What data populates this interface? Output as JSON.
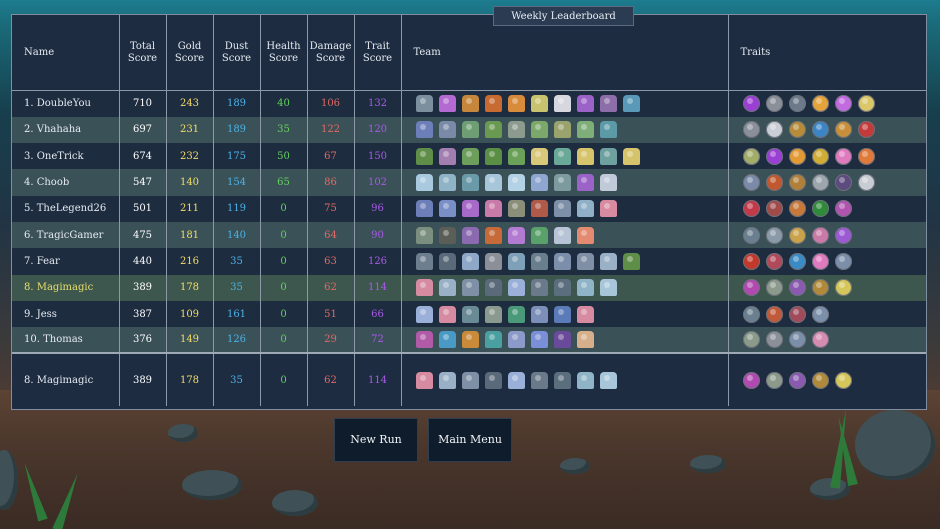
{
  "title": "Weekly Leaderboard",
  "headers": {
    "name": "Name",
    "total": [
      "Total",
      "Score"
    ],
    "gold": [
      "Gold",
      "Score"
    ],
    "dust": [
      "Dust",
      "Score"
    ],
    "health": [
      "Health",
      "Score"
    ],
    "damage": [
      "Damage",
      "Score"
    ],
    "trait": [
      "Trait",
      "Score"
    ],
    "team": "Team",
    "traits": "Traits"
  },
  "colors": {
    "total": "#ffffff",
    "gold": "#f3dd66",
    "dust": "#4bb2e6",
    "health": "#63d15c",
    "damage": "#e16a62",
    "trait": "#a85ae8",
    "highlight_name": "#e8de6a"
  },
  "rows": [
    {
      "name": "1. DoubleYou",
      "total": "710",
      "gold": "243",
      "dust": "189",
      "health": "40",
      "damage": "106",
      "trait": "132",
      "team": [
        "#7b8f9e",
        "#b46ad0",
        "#c6873c",
        "#c86b32",
        "#d88b3a",
        "#c9c36f",
        "#d7d7e0",
        "#9b63c7",
        "#8d6ea8",
        "#5a9ab8"
      ],
      "traits": [
        "#9b3fd4",
        "#8a8f98",
        "#6c7a8a",
        "#e4a33b",
        "#c26be0",
        "#d9c76a"
      ]
    },
    {
      "name": "2. Vhahaha",
      "total": "697",
      "gold": "231",
      "dust": "189",
      "health": "35",
      "damage": "122",
      "trait": "120",
      "team": [
        "#6d7fb8",
        "#7b8aa8",
        "#6e9e74",
        "#6a9a52",
        "#8c9b8e",
        "#7da86c",
        "#9aa36e",
        "#7fae78",
        "#5c9aa8"
      ],
      "traits": [
        "#8b8f99",
        "#c9ced6",
        "#b68c3a",
        "#3b84c6",
        "#c78f3a",
        "#c33a3a"
      ]
    },
    {
      "name": "3. OneTrick",
      "total": "674",
      "gold": "232",
      "dust": "175",
      "health": "50",
      "damage": "67",
      "trait": "150",
      "team": [
        "#5e8e48",
        "#a27fb0",
        "#6e9e5c",
        "#5a8e44",
        "#6aa057",
        "#d9c77a",
        "#6aa897",
        "#d6c46c",
        "#6fa0a0",
        "#d6c46c"
      ],
      "traits": [
        "#a2ad6a",
        "#9b3fd4",
        "#e49a33",
        "#d1ad36",
        "#e07abf",
        "#e07a3a"
      ]
    },
    {
      "name": "4. Choob",
      "total": "547",
      "gold": "140",
      "dust": "154",
      "health": "65",
      "damage": "86",
      "trait": "102",
      "team": [
        "#a9c9de",
        "#8fb3c7",
        "#6a9aa8",
        "#a8c6da",
        "#b3d2e6",
        "#8fa6d1",
        "#7d9a9e",
        "#9b63c7",
        "#c0cad8"
      ],
      "traits": [
        "#7a8aa8",
        "#c0592f",
        "#b0803a",
        "#9ea6ad",
        "#5d4a7e",
        "#c8cdd4"
      ]
    },
    {
      "name": "5. TheLegend26",
      "total": "501",
      "gold": "211",
      "dust": "119",
      "health": "0",
      "damage": "75",
      "trait": "96",
      "team": [
        "#6d7fb8",
        "#7a8fc8",
        "#a86ac9",
        "#c97aa8",
        "#8b8f7a",
        "#b05a4a",
        "#7d90a8",
        "#8fb0c7",
        "#d88ba0"
      ],
      "traits": [
        "#c23a4a",
        "#a04a4a",
        "#c8793a",
        "#2f8a3a",
        "#b054b0"
      ]
    },
    {
      "name": "6. TragicGamer",
      "total": "475",
      "gold": "181",
      "dust": "140",
      "health": "0",
      "damage": "64",
      "trait": "90",
      "team": [
        "#7b8f7e",
        "#5a5e56",
        "#8b6ab0",
        "#c66a3a",
        "#b27ad0",
        "#5aa06a",
        "#b7c4d6",
        "#e38a70"
      ],
      "traits": [
        "#6a8090",
        "#8b9aa8",
        "#c9a24a",
        "#c97aa8",
        "#9b5ad4"
      ]
    },
    {
      "name": "7. Fear",
      "total": "440",
      "gold": "216",
      "dust": "35",
      "health": "0",
      "damage": "63",
      "trait": "126",
      "team": [
        "#6d7f8e",
        "#5a6a7a",
        "#8fa8c7",
        "#8b8f98",
        "#7ea0b8",
        "#6a7f8e",
        "#7b8faa",
        "#7f90a6",
        "#9ab0c6",
        "#5e8e48"
      ],
      "traits": [
        "#c0392b",
        "#b04a5a",
        "#3a8ac6",
        "#e07abf",
        "#7b8faa"
      ]
    },
    {
      "name": "8. Magimagic",
      "total": "389",
      "gold": "178",
      "dust": "35",
      "health": "0",
      "damage": "62",
      "trait": "114",
      "self": true,
      "team": [
        "#d68ba0",
        "#9ab0c6",
        "#7f90a6",
        "#5a6a7a",
        "#9ab0d8",
        "#6a7a8a",
        "#5a6e7e",
        "#8fb3c7",
        "#a8c6da"
      ],
      "traits": [
        "#b04ab0",
        "#8b9a8a",
        "#8a5ab0",
        "#b08a3a",
        "#d4c65a"
      ]
    },
    {
      "name": "9. Jess",
      "total": "387",
      "gold": "109",
      "dust": "161",
      "health": "0",
      "damage": "51",
      "trait": "66",
      "team": [
        "#9ab0d8",
        "#d68ba0",
        "#6a8a96",
        "#8b9a8e",
        "#4a9a7a",
        "#7b8fb8",
        "#5a7ab8",
        "#d68ba0"
      ],
      "traits": [
        "#6a8090",
        "#c05a3a",
        "#a04a5a",
        "#7b8faa"
      ]
    },
    {
      "name": "10. Thomas",
      "total": "376",
      "gold": "149",
      "dust": "126",
      "health": "0",
      "damage": "29",
      "trait": "72",
      "team": [
        "#b05aa8",
        "#4a9ac6",
        "#c98a3a",
        "#4aa0a0",
        "#8b9ac8",
        "#7b8fd8",
        "#6a4a9a",
        "#d6b08a"
      ],
      "traits": [
        "#8b9a8a",
        "#8a8f98",
        "#7b8faa",
        "#d68bb0"
      ]
    }
  ],
  "summary": {
    "name": "8. Magimagic",
    "total": "389",
    "gold": "178",
    "dust": "35",
    "health": "0",
    "damage": "62",
    "trait": "114",
    "team": [
      "#d68ba0",
      "#9ab0c6",
      "#7f90a6",
      "#5a6a7a",
      "#9ab0d8",
      "#6a7a8a",
      "#5a6e7e",
      "#8fb3c7",
      "#a8c6da"
    ],
    "traits": [
      "#b04ab0",
      "#8b9a8a",
      "#8a5ab0",
      "#b08a3a",
      "#d4c65a"
    ]
  },
  "buttons": {
    "new_run": "New Run",
    "main_menu": "Main Menu"
  }
}
